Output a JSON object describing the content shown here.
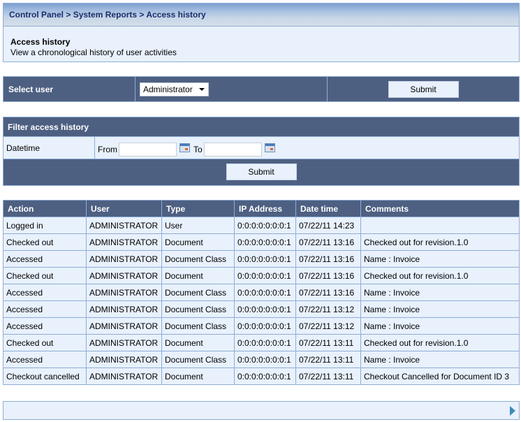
{
  "breadcrumb": [
    "Control Panel",
    "System Reports",
    "Access history"
  ],
  "breadcrumb_separator": " > ",
  "page": {
    "title": "Access history",
    "description": "View a chronological history of user activities"
  },
  "select_user": {
    "label": "Select user",
    "selected": "Administrator",
    "submit_label": "Submit"
  },
  "filter": {
    "title": "Filter access history",
    "field_label": "Datetime",
    "from_label": "From",
    "to_label": "To",
    "from_value": "",
    "to_value": "",
    "submit_label": "Submit"
  },
  "table": {
    "columns": [
      "Action",
      "User",
      "Type",
      "IP Address",
      "Date time",
      "Comments"
    ],
    "rows": [
      [
        "Logged in",
        "ADMINISTRATOR",
        "User",
        "0:0:0:0:0:0:0:1",
        "07/22/11 14:23",
        ""
      ],
      [
        "Checked out",
        "ADMINISTRATOR",
        "Document",
        "0:0:0:0:0:0:0:1",
        "07/22/11 13:16",
        "Checked out for revision.1.0"
      ],
      [
        "Accessed",
        "ADMINISTRATOR",
        "Document Class",
        "0:0:0:0:0:0:0:1",
        "07/22/11 13:16",
        "Name : Invoice"
      ],
      [
        "Checked out",
        "ADMINISTRATOR",
        "Document",
        "0:0:0:0:0:0:0:1",
        "07/22/11 13:16",
        "Checked out for revision.1.0"
      ],
      [
        "Accessed",
        "ADMINISTRATOR",
        "Document Class",
        "0:0:0:0:0:0:0:1",
        "07/22/11 13:16",
        "Name : Invoice"
      ],
      [
        "Accessed",
        "ADMINISTRATOR",
        "Document Class",
        "0:0:0:0:0:0:0:1",
        "07/22/11 13:12",
        "Name : Invoice"
      ],
      [
        "Accessed",
        "ADMINISTRATOR",
        "Document Class",
        "0:0:0:0:0:0:0:1",
        "07/22/11 13:12",
        "Name : Invoice"
      ],
      [
        "Checked out",
        "ADMINISTRATOR",
        "Document",
        "0:0:0:0:0:0:0:1",
        "07/22/11 13:11",
        "Checked out for revision.1.0"
      ],
      [
        "Accessed",
        "ADMINISTRATOR",
        "Document Class",
        "0:0:0:0:0:0:0:1",
        "07/22/11 13:11",
        "Name : Invoice"
      ],
      [
        "Checkout cancelled",
        "ADMINISTRATOR",
        "Document",
        "0:0:0:0:0:0:0:1",
        "07/22/11 13:11",
        "Checkout Cancelled for Document ID 3"
      ]
    ]
  },
  "pager": {
    "next_icon": "next-page-arrow"
  },
  "colors": {
    "panel": "#4e6082",
    "light": "#e8f1fc",
    "border": "#8fadd4",
    "breadcrumb": "#1a2e6b"
  }
}
